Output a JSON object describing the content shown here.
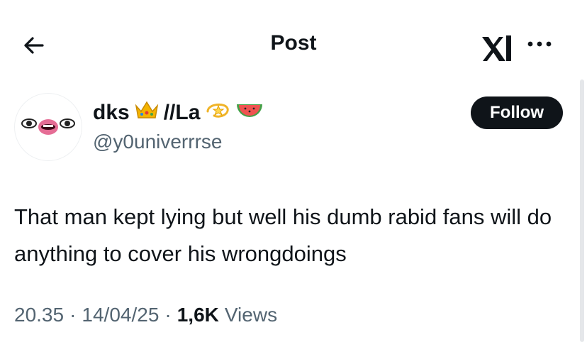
{
  "header": {
    "title": "Post",
    "back_icon": "arrow-left-icon",
    "brand_icon": "x-logo-icon",
    "more_icon": "more-horizontal-icon"
  },
  "author": {
    "display_name_part1": "dks",
    "display_name_part2": "//La",
    "emoji_icons": [
      "crown-icon",
      "dizzy-icon",
      "watermelon-icon"
    ],
    "handle": "@y0univerrrse",
    "avatar_icon": "eyes-and-lips-avatar"
  },
  "follow": {
    "label": "Follow"
  },
  "tweet": {
    "text": "That man kept lying but well his dumb rabid fans will do anything to cover his wrongdoings"
  },
  "meta": {
    "time": "20.35",
    "separator1": "·",
    "date": "14/04/25",
    "separator2": "·",
    "views_count": "1,6K",
    "views_label": "Views"
  },
  "colors": {
    "text_primary": "#0f1419",
    "text_secondary": "#536471",
    "button_bg": "#0f1419"
  }
}
